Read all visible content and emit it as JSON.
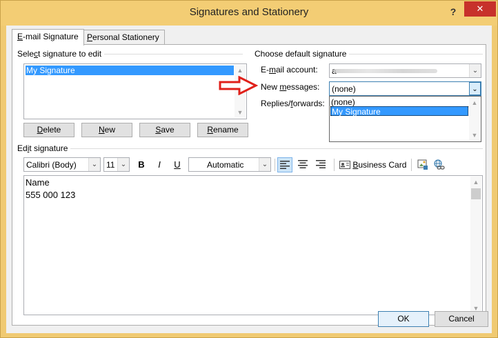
{
  "window": {
    "title": "Signatures and Stationery",
    "help": "?",
    "close": "✕"
  },
  "tabs": [
    {
      "label_u": "E",
      "label_rest": "-mail Signature",
      "active": true
    },
    {
      "label_u": "P",
      "label_rest": "ersonal Stationery",
      "active": false
    }
  ],
  "select_group": {
    "label_pre": "Sele",
    "label_u": "c",
    "label_post": "t signature to edit"
  },
  "signatures": [
    {
      "name": "My Signature",
      "selected": true
    }
  ],
  "sig_buttons": {
    "delete": {
      "u": "D",
      "rest": "elete"
    },
    "new": {
      "u": "N",
      "rest": "ew"
    },
    "save": {
      "u": "S",
      "rest": "ave"
    },
    "rename": {
      "u": "R",
      "rest": "ename"
    }
  },
  "default_group": {
    "label": "Choose default signature"
  },
  "email_account": {
    "label_pre": "E-",
    "label_u": "m",
    "label_post": "ail account:",
    "value": "a"
  },
  "new_messages": {
    "label_pre": "New ",
    "label_u": "m",
    "label_post": "essages:",
    "value": "(none)",
    "options": [
      "(none)",
      "My Signature"
    ],
    "highlighted": "My Signature"
  },
  "replies": {
    "label_pre": "Replies/",
    "label_u": "f",
    "label_post": "orwards:"
  },
  "edit_group": {
    "label_pre": "Ed",
    "label_u": "i",
    "label_post": "t signature"
  },
  "toolbar": {
    "font": "Calibri (Body)",
    "size": "11",
    "bold": "B",
    "italic": "I",
    "underline": "U",
    "color": "Automatic",
    "business_card_u": "B",
    "business_card_rest": "usiness Card"
  },
  "signature_text": [
    "Name",
    "555 000 123"
  ],
  "footer": {
    "ok": "OK",
    "cancel": "Cancel"
  },
  "colors": {
    "title_bar": "#f3cd74",
    "close_button": "#c7312b",
    "selection": "#3399ff",
    "arrow": "#e0201a"
  }
}
